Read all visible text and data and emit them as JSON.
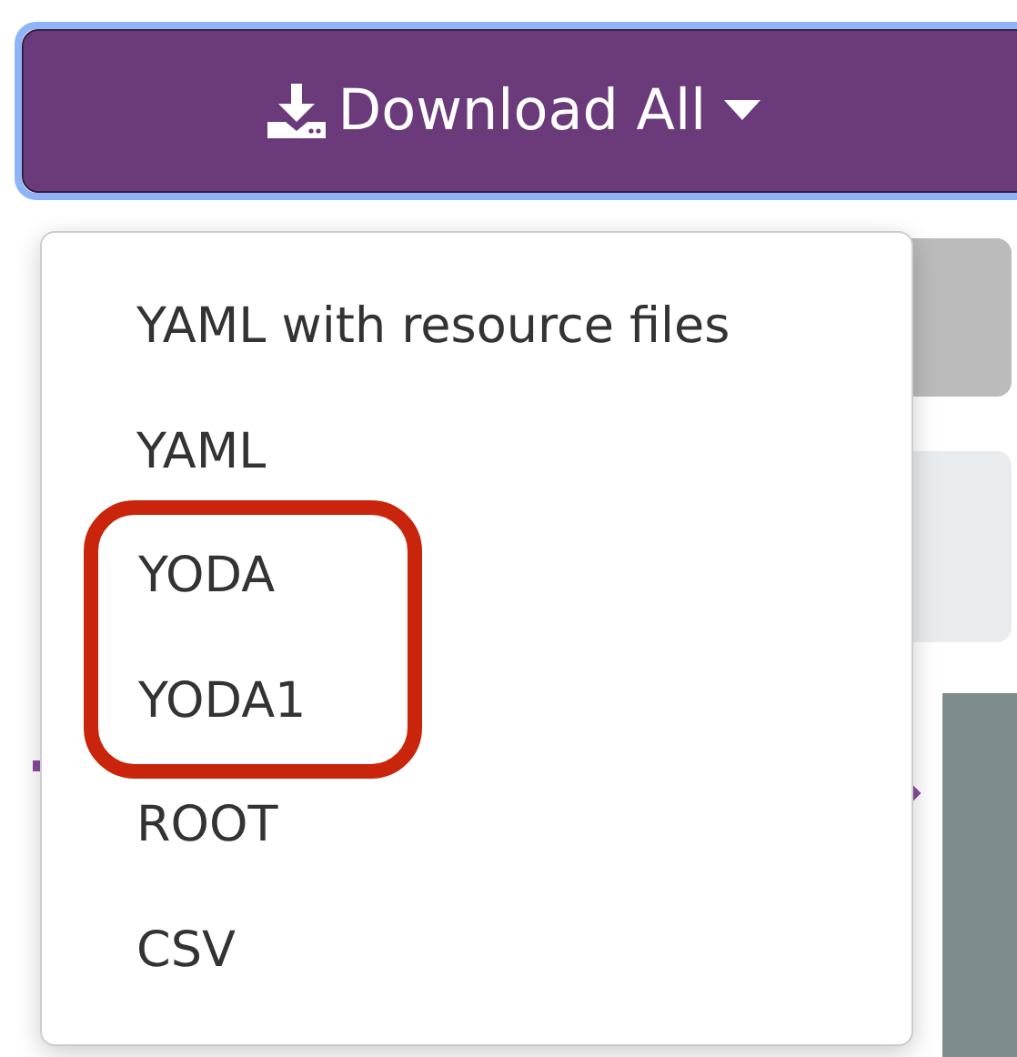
{
  "download_button": {
    "label": "Download All"
  },
  "menu": {
    "items": [
      {
        "label": "YAML with resource files",
        "highlighted": false
      },
      {
        "label": "YAML",
        "highlighted": false
      },
      {
        "label": "YODA",
        "highlighted": true
      },
      {
        "label": "YODA1",
        "highlighted": true
      },
      {
        "label": "ROOT",
        "highlighted": false
      },
      {
        "label": "CSV",
        "highlighted": false
      }
    ]
  }
}
